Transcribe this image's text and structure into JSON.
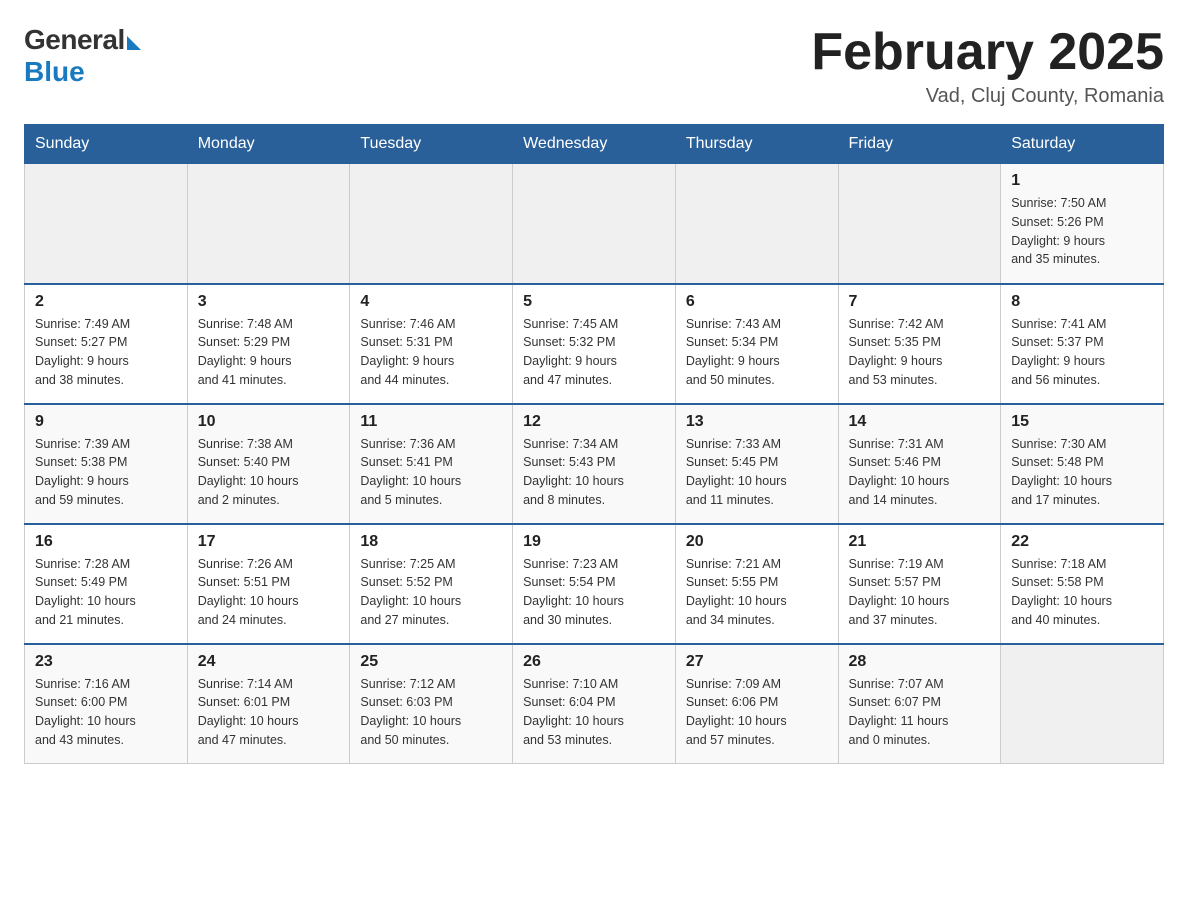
{
  "header": {
    "logo_general": "General",
    "logo_blue": "Blue",
    "calendar_title": "February 2025",
    "calendar_subtitle": "Vad, Cluj County, Romania"
  },
  "days_of_week": [
    "Sunday",
    "Monday",
    "Tuesday",
    "Wednesday",
    "Thursday",
    "Friday",
    "Saturday"
  ],
  "weeks": [
    [
      {
        "day": "",
        "info": ""
      },
      {
        "day": "",
        "info": ""
      },
      {
        "day": "",
        "info": ""
      },
      {
        "day": "",
        "info": ""
      },
      {
        "day": "",
        "info": ""
      },
      {
        "day": "",
        "info": ""
      },
      {
        "day": "1",
        "info": "Sunrise: 7:50 AM\nSunset: 5:26 PM\nDaylight: 9 hours\nand 35 minutes."
      }
    ],
    [
      {
        "day": "2",
        "info": "Sunrise: 7:49 AM\nSunset: 5:27 PM\nDaylight: 9 hours\nand 38 minutes."
      },
      {
        "day": "3",
        "info": "Sunrise: 7:48 AM\nSunset: 5:29 PM\nDaylight: 9 hours\nand 41 minutes."
      },
      {
        "day": "4",
        "info": "Sunrise: 7:46 AM\nSunset: 5:31 PM\nDaylight: 9 hours\nand 44 minutes."
      },
      {
        "day": "5",
        "info": "Sunrise: 7:45 AM\nSunset: 5:32 PM\nDaylight: 9 hours\nand 47 minutes."
      },
      {
        "day": "6",
        "info": "Sunrise: 7:43 AM\nSunset: 5:34 PM\nDaylight: 9 hours\nand 50 minutes."
      },
      {
        "day": "7",
        "info": "Sunrise: 7:42 AM\nSunset: 5:35 PM\nDaylight: 9 hours\nand 53 minutes."
      },
      {
        "day": "8",
        "info": "Sunrise: 7:41 AM\nSunset: 5:37 PM\nDaylight: 9 hours\nand 56 minutes."
      }
    ],
    [
      {
        "day": "9",
        "info": "Sunrise: 7:39 AM\nSunset: 5:38 PM\nDaylight: 9 hours\nand 59 minutes."
      },
      {
        "day": "10",
        "info": "Sunrise: 7:38 AM\nSunset: 5:40 PM\nDaylight: 10 hours\nand 2 minutes."
      },
      {
        "day": "11",
        "info": "Sunrise: 7:36 AM\nSunset: 5:41 PM\nDaylight: 10 hours\nand 5 minutes."
      },
      {
        "day": "12",
        "info": "Sunrise: 7:34 AM\nSunset: 5:43 PM\nDaylight: 10 hours\nand 8 minutes."
      },
      {
        "day": "13",
        "info": "Sunrise: 7:33 AM\nSunset: 5:45 PM\nDaylight: 10 hours\nand 11 minutes."
      },
      {
        "day": "14",
        "info": "Sunrise: 7:31 AM\nSunset: 5:46 PM\nDaylight: 10 hours\nand 14 minutes."
      },
      {
        "day": "15",
        "info": "Sunrise: 7:30 AM\nSunset: 5:48 PM\nDaylight: 10 hours\nand 17 minutes."
      }
    ],
    [
      {
        "day": "16",
        "info": "Sunrise: 7:28 AM\nSunset: 5:49 PM\nDaylight: 10 hours\nand 21 minutes."
      },
      {
        "day": "17",
        "info": "Sunrise: 7:26 AM\nSunset: 5:51 PM\nDaylight: 10 hours\nand 24 minutes."
      },
      {
        "day": "18",
        "info": "Sunrise: 7:25 AM\nSunset: 5:52 PM\nDaylight: 10 hours\nand 27 minutes."
      },
      {
        "day": "19",
        "info": "Sunrise: 7:23 AM\nSunset: 5:54 PM\nDaylight: 10 hours\nand 30 minutes."
      },
      {
        "day": "20",
        "info": "Sunrise: 7:21 AM\nSunset: 5:55 PM\nDaylight: 10 hours\nand 34 minutes."
      },
      {
        "day": "21",
        "info": "Sunrise: 7:19 AM\nSunset: 5:57 PM\nDaylight: 10 hours\nand 37 minutes."
      },
      {
        "day": "22",
        "info": "Sunrise: 7:18 AM\nSunset: 5:58 PM\nDaylight: 10 hours\nand 40 minutes."
      }
    ],
    [
      {
        "day": "23",
        "info": "Sunrise: 7:16 AM\nSunset: 6:00 PM\nDaylight: 10 hours\nand 43 minutes."
      },
      {
        "day": "24",
        "info": "Sunrise: 7:14 AM\nSunset: 6:01 PM\nDaylight: 10 hours\nand 47 minutes."
      },
      {
        "day": "25",
        "info": "Sunrise: 7:12 AM\nSunset: 6:03 PM\nDaylight: 10 hours\nand 50 minutes."
      },
      {
        "day": "26",
        "info": "Sunrise: 7:10 AM\nSunset: 6:04 PM\nDaylight: 10 hours\nand 53 minutes."
      },
      {
        "day": "27",
        "info": "Sunrise: 7:09 AM\nSunset: 6:06 PM\nDaylight: 10 hours\nand 57 minutes."
      },
      {
        "day": "28",
        "info": "Sunrise: 7:07 AM\nSunset: 6:07 PM\nDaylight: 11 hours\nand 0 minutes."
      },
      {
        "day": "",
        "info": ""
      }
    ]
  ]
}
